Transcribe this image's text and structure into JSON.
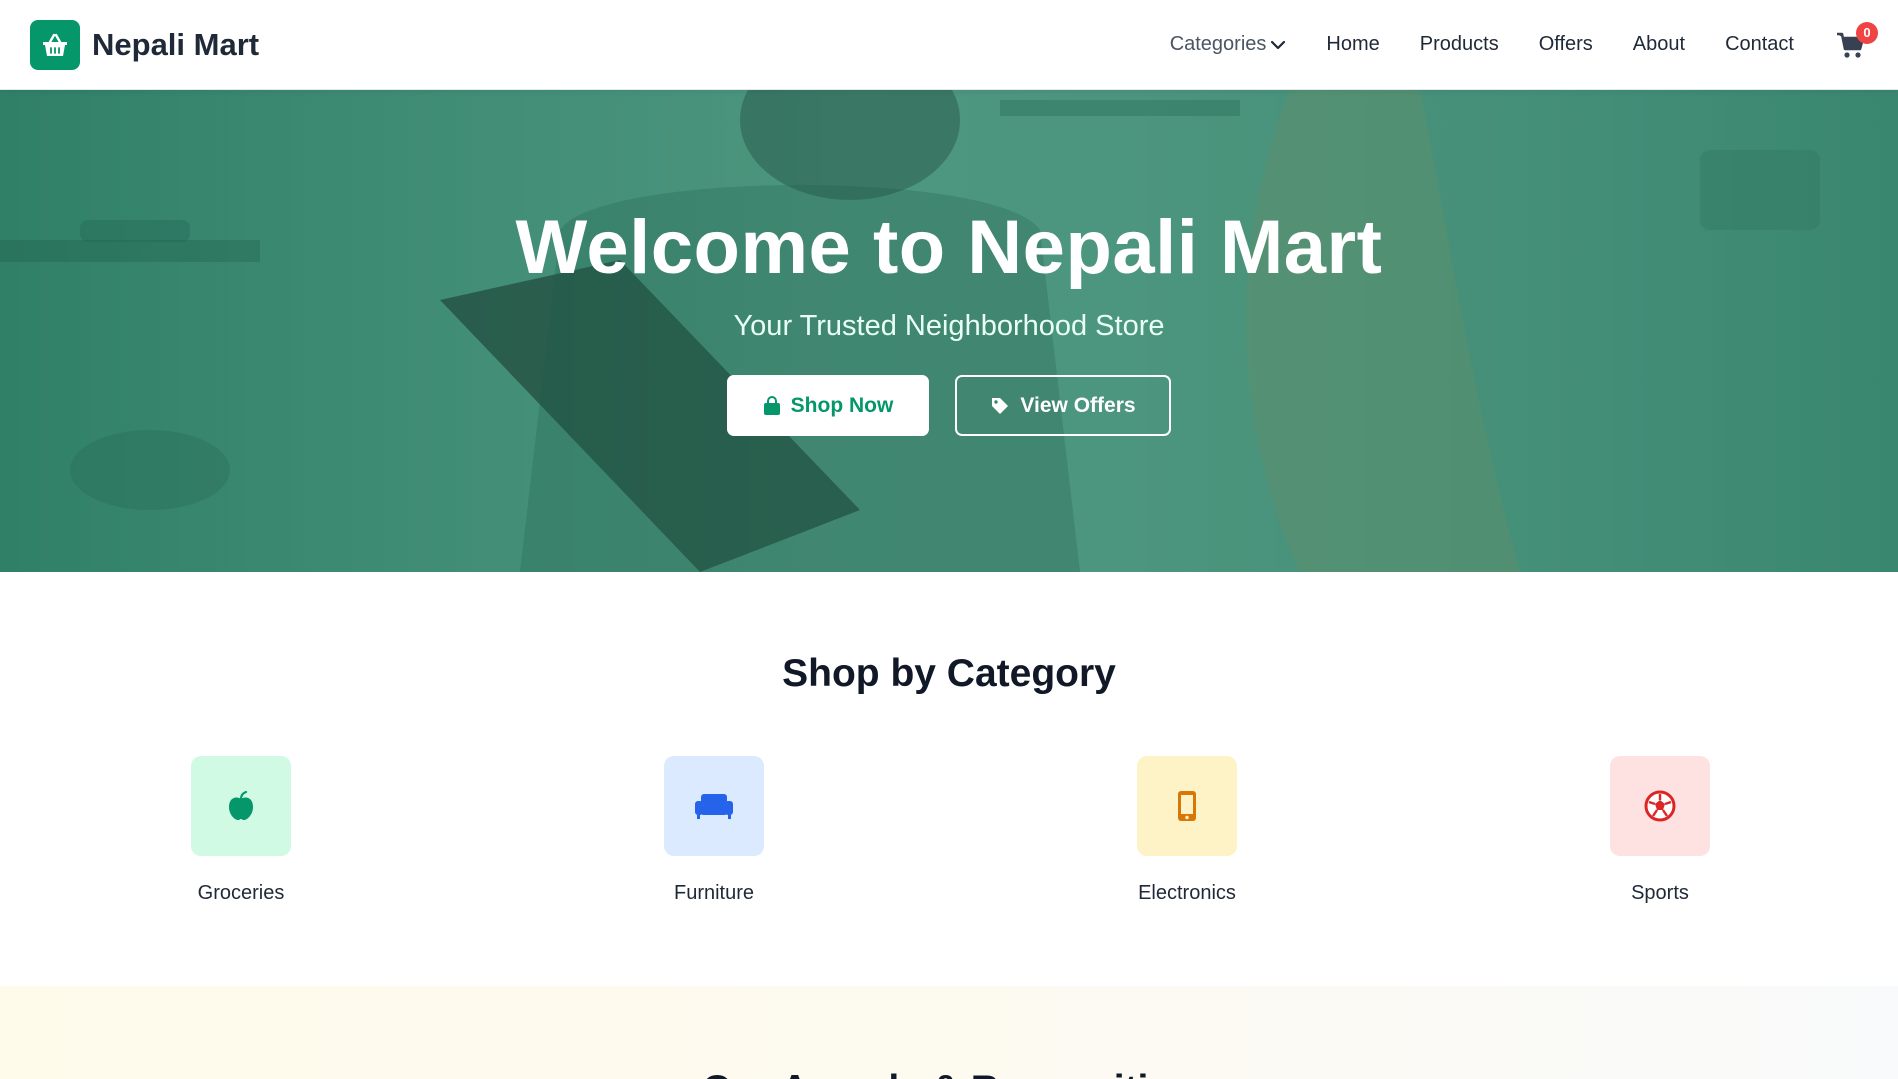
{
  "brand": {
    "name": "Nepali Mart",
    "logo_icon": "shopping-basket-icon",
    "accent": "#059669"
  },
  "nav": {
    "categories_label": "Categories",
    "links": [
      "Home",
      "Products",
      "Offers",
      "About",
      "Contact"
    ],
    "cart_count": "0"
  },
  "hero": {
    "title": "Welcome to Nepali Mart",
    "subtitle": "Your Trusted Neighborhood Store",
    "primary_button": "Shop Now",
    "secondary_button": "View Offers",
    "overlay_color": "#197c5f"
  },
  "categories": {
    "title": "Shop by Category",
    "items": [
      {
        "label": "Groceries",
        "icon": "apple-icon",
        "tile_color": "#d1fae5",
        "icon_color": "#059669"
      },
      {
        "label": "Furniture",
        "icon": "couch-icon",
        "tile_color": "#dbeafe",
        "icon_color": "#2563eb"
      },
      {
        "label": "Electronics",
        "icon": "mobile-icon",
        "tile_color": "#fef3c7",
        "icon_color": "#d97706"
      },
      {
        "label": "Sports",
        "icon": "football-icon",
        "tile_color": "#fee2e2",
        "icon_color": "#dc2626"
      }
    ]
  },
  "next_section": {
    "title": "Our Awards & Recognition"
  }
}
